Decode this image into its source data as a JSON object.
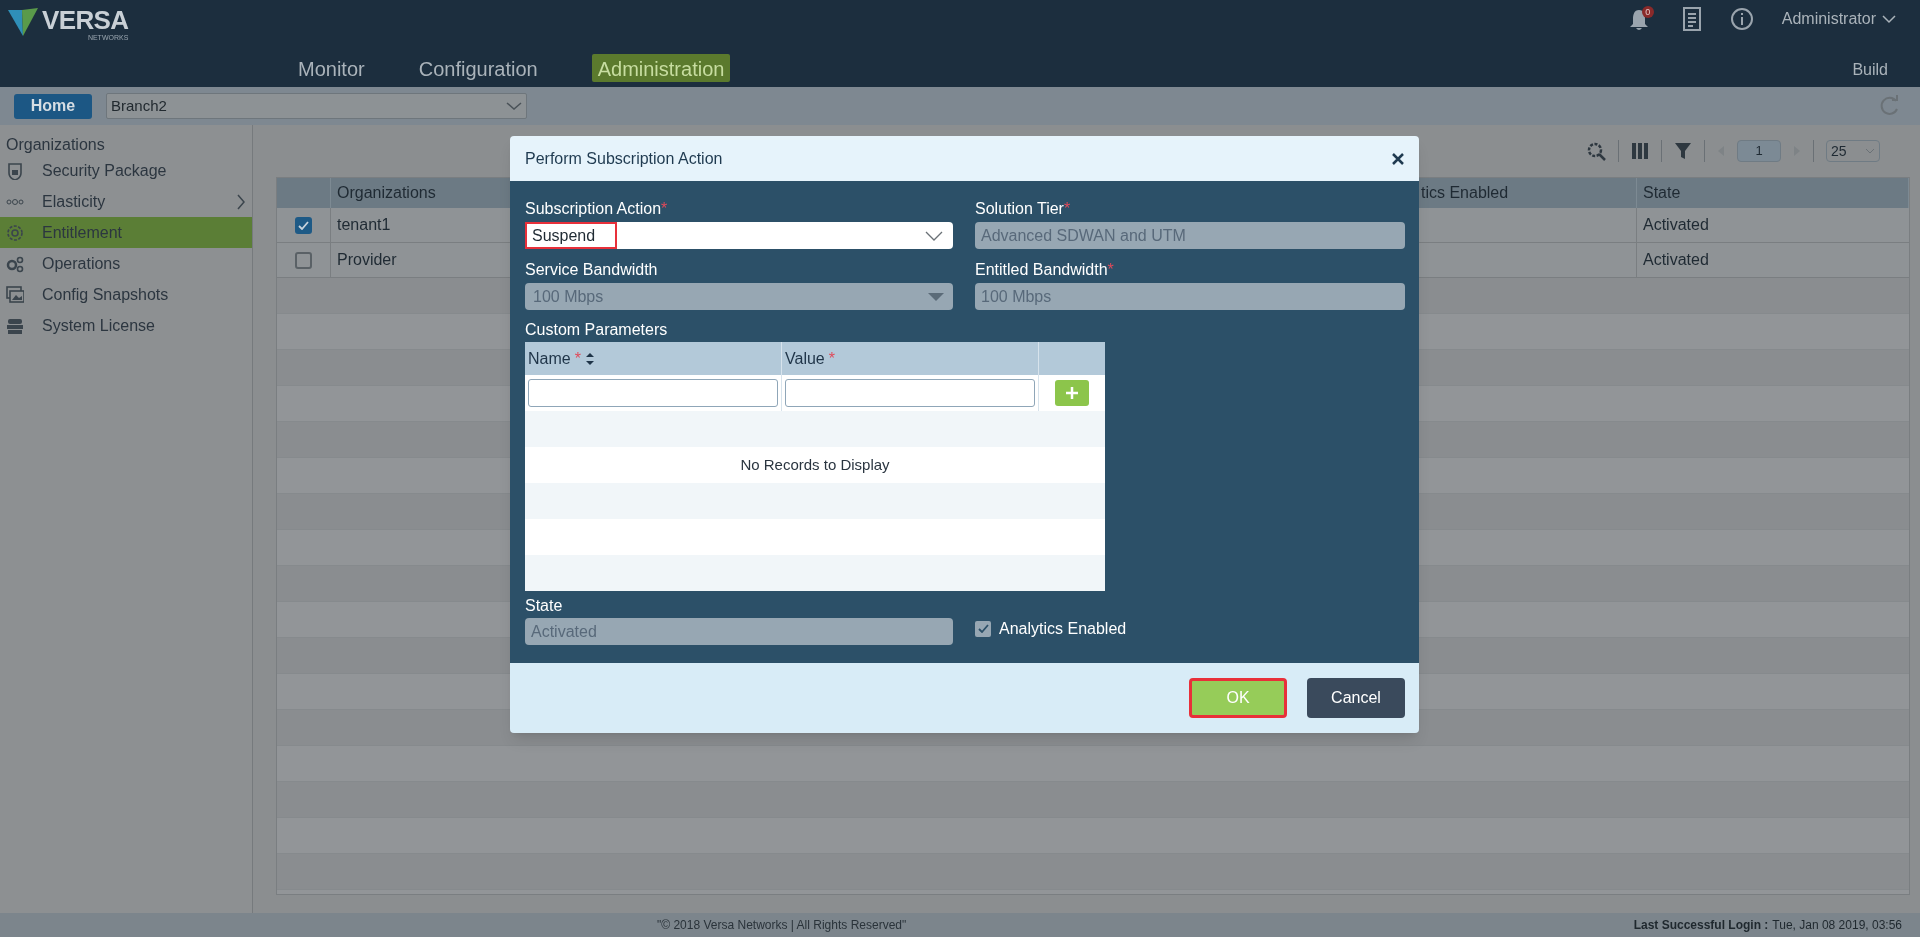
{
  "header": {
    "logo_text": "VERSA",
    "logo_subtext": "NETWORKS",
    "nav": [
      {
        "label": "Monitor",
        "selected": false
      },
      {
        "label": "Configuration",
        "selected": false
      },
      {
        "label": "Administration",
        "selected": true
      }
    ],
    "notification_count": "0",
    "user": "Administrator",
    "build": "Build"
  },
  "context_bar": {
    "home": "Home",
    "appliance": "Branch2"
  },
  "sidebar": {
    "heading": "Organizations",
    "items": [
      {
        "label": "Security Package",
        "selected": false,
        "expandable": false
      },
      {
        "label": "Elasticity",
        "selected": false,
        "expandable": true
      },
      {
        "label": "Entitlement",
        "selected": true,
        "expandable": false
      },
      {
        "label": "Operations",
        "selected": false,
        "expandable": false
      },
      {
        "label": "Config Snapshots",
        "selected": false,
        "expandable": false
      },
      {
        "label": "System License",
        "selected": false,
        "expandable": false
      }
    ]
  },
  "pager": {
    "page": "1",
    "page_size": "25"
  },
  "table": {
    "columns": [
      "Organizations",
      "tics Enabled",
      "State"
    ],
    "rows": [
      {
        "checked": true,
        "organization": "tenant1",
        "state": "Activated"
      },
      {
        "checked": false,
        "organization": "Provider",
        "state": "Activated"
      }
    ]
  },
  "dialog": {
    "title": "Perform Subscription Action",
    "fields": [
      {
        "label": "Subscription Action",
        "required_mark": "*",
        "value": "Suspend",
        "kind": "select",
        "highlighted": true
      },
      {
        "label": "Solution Tier",
        "required_mark": "*",
        "value": "Advanced SDWAN and UTM",
        "kind": "readonly"
      },
      {
        "label": "Service Bandwidth",
        "value": "100 Mbps",
        "kind": "readonly-select"
      },
      {
        "label": "Entitled Bandwidth",
        "required_mark": "*",
        "value": "100 Mbps",
        "kind": "readonly"
      }
    ],
    "custom_parameters": {
      "label": "Custom Parameters",
      "columns": [
        {
          "label": "Name",
          "required_mark": "*",
          "sortable": true
        },
        {
          "label": "Value",
          "required_mark": "*"
        }
      ],
      "empty_text": "No Records to Display"
    },
    "state": {
      "label": "State",
      "value": "Activated"
    },
    "analytics": {
      "label": "Analytics Enabled",
      "checked": true
    },
    "buttons": [
      {
        "label": "OK",
        "kind": "primary",
        "highlighted": true
      },
      {
        "label": "Cancel",
        "kind": "secondary",
        "highlighted": false
      }
    ]
  },
  "footer": {
    "copyright": "\"© 2018 Versa Networks | All Rights Reserved\"",
    "last_login_label": "Last Successful Login :",
    "last_login_value": "Tue, Jan 08 2019, 03:56"
  }
}
